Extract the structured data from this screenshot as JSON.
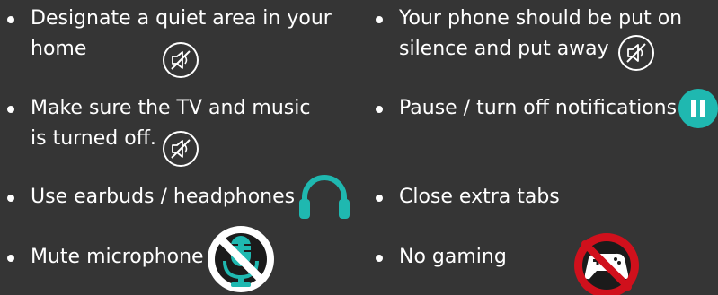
{
  "left": {
    "items": [
      {
        "lines": [
          "Designate a quiet area in your",
          "home"
        ],
        "icon": "muted-speaker-icon"
      },
      {
        "lines": [
          "Make sure the TV  and music",
          "is turned off."
        ],
        "icon": "muted-speaker-icon"
      },
      {
        "lines": [
          "Use earbuds / headphones"
        ],
        "icon": "headphones-icon"
      },
      {
        "lines": [
          "Mute microphone"
        ],
        "icon": "no-microphone-icon"
      }
    ]
  },
  "right": {
    "items": [
      {
        "lines": [
          "Your phone should be put on",
          "silence and put away"
        ],
        "icon": "muted-speaker-icon"
      },
      {
        "lines": [
          "Pause / turn off notifications"
        ],
        "icon": "pause-icon"
      },
      {
        "lines": [
          "Close extra tabs"
        ],
        "icon": ""
      },
      {
        "lines": [
          "No gaming"
        ],
        "icon": "no-gaming-icon"
      }
    ]
  },
  "colors": {
    "background": "#353535",
    "text": "#ffffff",
    "teal": "#1fb8b0",
    "prohibit_red": "#d0101c"
  }
}
